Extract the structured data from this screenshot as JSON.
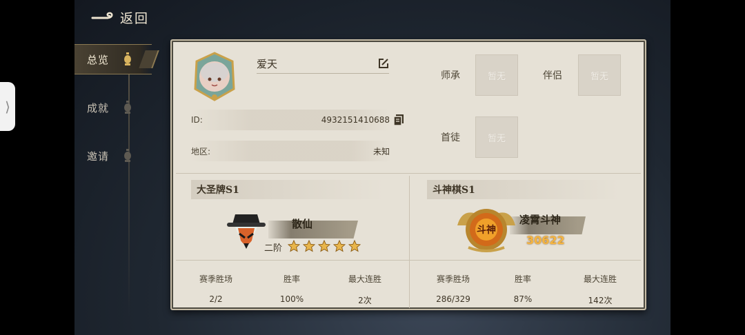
{
  "back": {
    "label": "返回"
  },
  "nav": [
    {
      "label": "总览",
      "active": true
    },
    {
      "label": "成就",
      "active": false
    },
    {
      "label": "邀请",
      "active": false
    }
  ],
  "profile": {
    "name": "爱天",
    "id_label": "ID:",
    "id_value": "4932151410688",
    "region_label": "地区:",
    "region_value": "未知"
  },
  "relations": {
    "master_label": "师承",
    "partner_label": "伴侣",
    "disciple_label": "首徒",
    "empty_text": "暂无"
  },
  "seasons": [
    {
      "title": "大圣牌S1",
      "rank_name": "散仙",
      "rank_tier": "二阶",
      "stars": 5,
      "stats": [
        {
          "label": "赛季胜场",
          "value": "2/2"
        },
        {
          "label": "胜率",
          "value": "100%"
        },
        {
          "label": "最大连胜",
          "value": "2次"
        }
      ]
    },
    {
      "title": "斗神棋S1",
      "rank_name": "凌霄斗神",
      "badge_text": "斗神",
      "score": "30622",
      "stats": [
        {
          "label": "赛季胜场",
          "value": "286/329"
        },
        {
          "label": "胜率",
          "value": "87%"
        },
        {
          "label": "最大连胜",
          "value": "142次"
        }
      ]
    }
  ],
  "colors": {
    "card_bg": "#e6e1d6",
    "gold": "#e8b54b",
    "text_dark": "#3e3526"
  }
}
